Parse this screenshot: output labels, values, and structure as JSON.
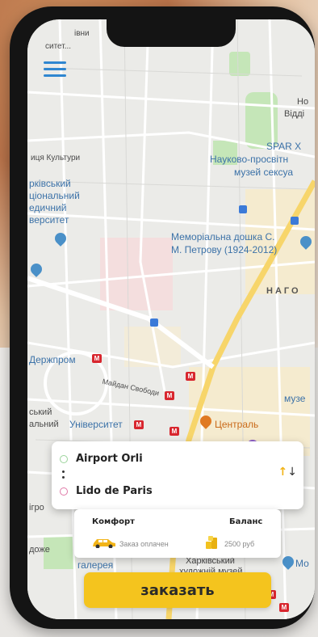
{
  "map": {
    "labels": {
      "top_left_1": "івни",
      "top_left_2": "ситет...",
      "street_1": "иця Культури",
      "uni_1": "рківський",
      "uni_2": "ціональний",
      "uni_3": "едичний",
      "uni_4": "верситет",
      "right_1": "Но",
      "right_2": "Відді",
      "spar": "SPAR X",
      "museum_1": "Науково-просвітн",
      "museum_2": "музей сексуа",
      "memorial_1": "Меморіальна дошка С.",
      "memorial_2": "М. Петрову (1924-2012)",
      "district": "НАГО",
      "derzhprom": "Держпром",
      "street_2": "Майдан Свободи",
      "museum_3": "музе",
      "uni_b_1": "ський",
      "uni_b_2": "альний",
      "university": "Університет",
      "centraal": "Централь",
      "left_3": "ігро",
      "left_4": "доже",
      "gallery": "галерея",
      "art_museum_1": "Харківський",
      "art_museum_2": "художній музей",
      "mo": "Мо"
    },
    "metro_symbol": "M"
  },
  "route": {
    "from": "Airport Orli",
    "to": "Lido de Paris",
    "swap_icon": "swap-arrows-icon"
  },
  "tariff": {
    "class_title": "Комфорт",
    "balance_title": "Баланс",
    "payment_status": "Заказ оплачен",
    "balance_value": "2500 руб"
  },
  "order_button": "заказать",
  "colors": {
    "accent_yellow": "#f4c41e",
    "menu_blue": "#2f86d0",
    "metro_red": "#d8262e",
    "road_yellow": "#f7d56a"
  }
}
